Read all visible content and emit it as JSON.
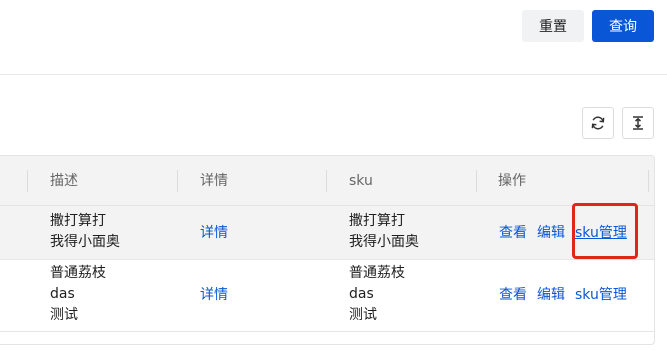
{
  "toolbar": {
    "reset_label": "重置",
    "query_label": "查询"
  },
  "table": {
    "columns": [
      "描述",
      "详情",
      "sku",
      "操作"
    ],
    "rows": [
      {
        "description": [
          "撒打算打",
          "我得小面奥"
        ],
        "detail": "详情",
        "sku": [
          "撒打算打",
          "我得小面奥"
        ],
        "actions": [
          "查看",
          "编辑",
          "sku管理"
        ]
      },
      {
        "description": [
          "普通荔枝",
          "das",
          "测试"
        ],
        "detail": "详情",
        "sku": [
          "普通荔枝",
          "das",
          "测试"
        ],
        "actions": [
          "查看",
          "编辑",
          "sku管理"
        ]
      }
    ]
  },
  "colors": {
    "primary": "#0957d6",
    "highlight": "#e0251b"
  },
  "icons": [
    "refresh-icon",
    "row-height-icon"
  ]
}
